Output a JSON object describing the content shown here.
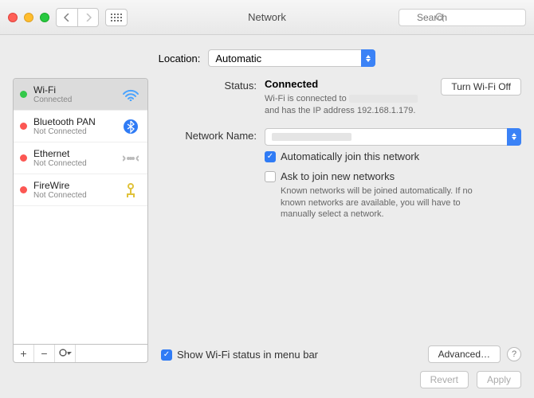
{
  "window": {
    "title": "Network",
    "search_placeholder": "Search"
  },
  "location": {
    "label": "Location:",
    "value": "Automatic"
  },
  "sidebar": {
    "items": [
      {
        "name": "Wi-Fi",
        "sub": "Connected",
        "status": "green",
        "icon": "wifi"
      },
      {
        "name": "Bluetooth PAN",
        "sub": "Not Connected",
        "status": "red",
        "icon": "bluetooth"
      },
      {
        "name": "Ethernet",
        "sub": "Not Connected",
        "status": "red",
        "icon": "ethernet"
      },
      {
        "name": "FireWire",
        "sub": "Not Connected",
        "status": "red",
        "icon": "firewire"
      }
    ]
  },
  "main": {
    "status_label": "Status:",
    "status_value": "Connected",
    "wifi_toggle": "Turn Wi-Fi Off",
    "status_note_a": "Wi-Fi is connected to ",
    "status_note_b": " and has the IP address 192.168.1.179.",
    "network_name_label": "Network Name:",
    "network_name_value": " ",
    "auto_join": "Automatically join this network",
    "ask_join": "Ask to join new networks",
    "ask_help": "Known networks will be joined automatically. If no known networks are available, you will have to manually select a network.",
    "show_status": "Show Wi-Fi status in menu bar",
    "advanced": "Advanced…"
  },
  "footer": {
    "revert": "Revert",
    "apply": "Apply"
  }
}
